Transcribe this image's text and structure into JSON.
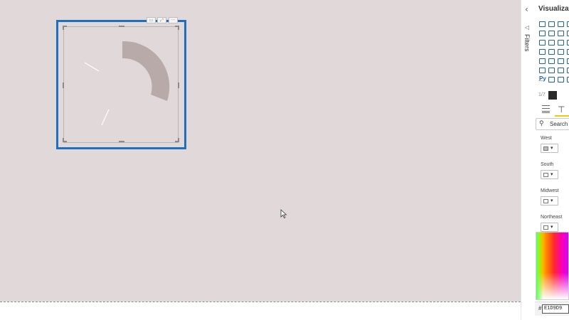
{
  "filters_pane": {
    "label": "Filters",
    "collapse_icon": "chevron-left-icon",
    "filter_icon": "funnel-icon"
  },
  "visualizations_pane": {
    "title": "Visualizations",
    "more_label": "...",
    "custom_visual_tooltip_icon": "custom-visual-icon",
    "python_label": "Py",
    "tabs": {
      "fields_icon": "fields-tab-icon",
      "format_icon": "paint-roller-icon",
      "active": "format"
    },
    "search": {
      "placeholder": "Search"
    },
    "data_colors": [
      {
        "label": "West",
        "swatch": "#bdbdbd"
      },
      {
        "label": "South",
        "swatch": "#ffffff"
      },
      {
        "label": "Midwest",
        "swatch": "#ffffff"
      },
      {
        "label": "Northeast",
        "swatch": "#ffffff"
      }
    ],
    "hex_input": {
      "prefix": "#",
      "value": "E1D9D9"
    }
  },
  "report_canvas": {
    "background": "#e1d9d9",
    "selected_visual": {
      "type": "donut",
      "arc_color": "#b9aaaa",
      "border_color": "#1e6fbf"
    }
  }
}
